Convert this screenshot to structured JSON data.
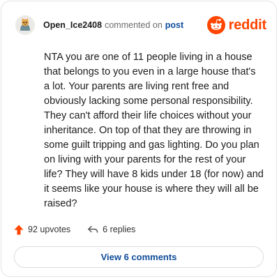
{
  "header": {
    "username": "Open_Ice2408",
    "commented_text": "commented on",
    "post_link": "post",
    "brand_word": "reddit",
    "brand_color": "#ff4500"
  },
  "comment": {
    "body": "NTA you are one of 11 people living in a house that belongs to you even in a large house that's a lot. Your parents are living rent free and obviously lacking some personal responsibility. They can't afford their life choices without your inheritance. On top of that they are throwing in some guilt tripping and gas lighting. Do you plan on living with your parents for the rest of your life? They will have 8 kids under 18 (for now) and it seems like your house is where they will all be raised?"
  },
  "actions": {
    "upvote_icon": "upvote-arrow-icon",
    "upvotes_label": "92 upvotes",
    "reply_icon": "reply-arrow-icon",
    "replies_label": "6 replies"
  },
  "footer": {
    "view_comments_label": "View 6 comments"
  },
  "colors": {
    "link": "#0f4c9a",
    "upvote": "#ff4500"
  }
}
